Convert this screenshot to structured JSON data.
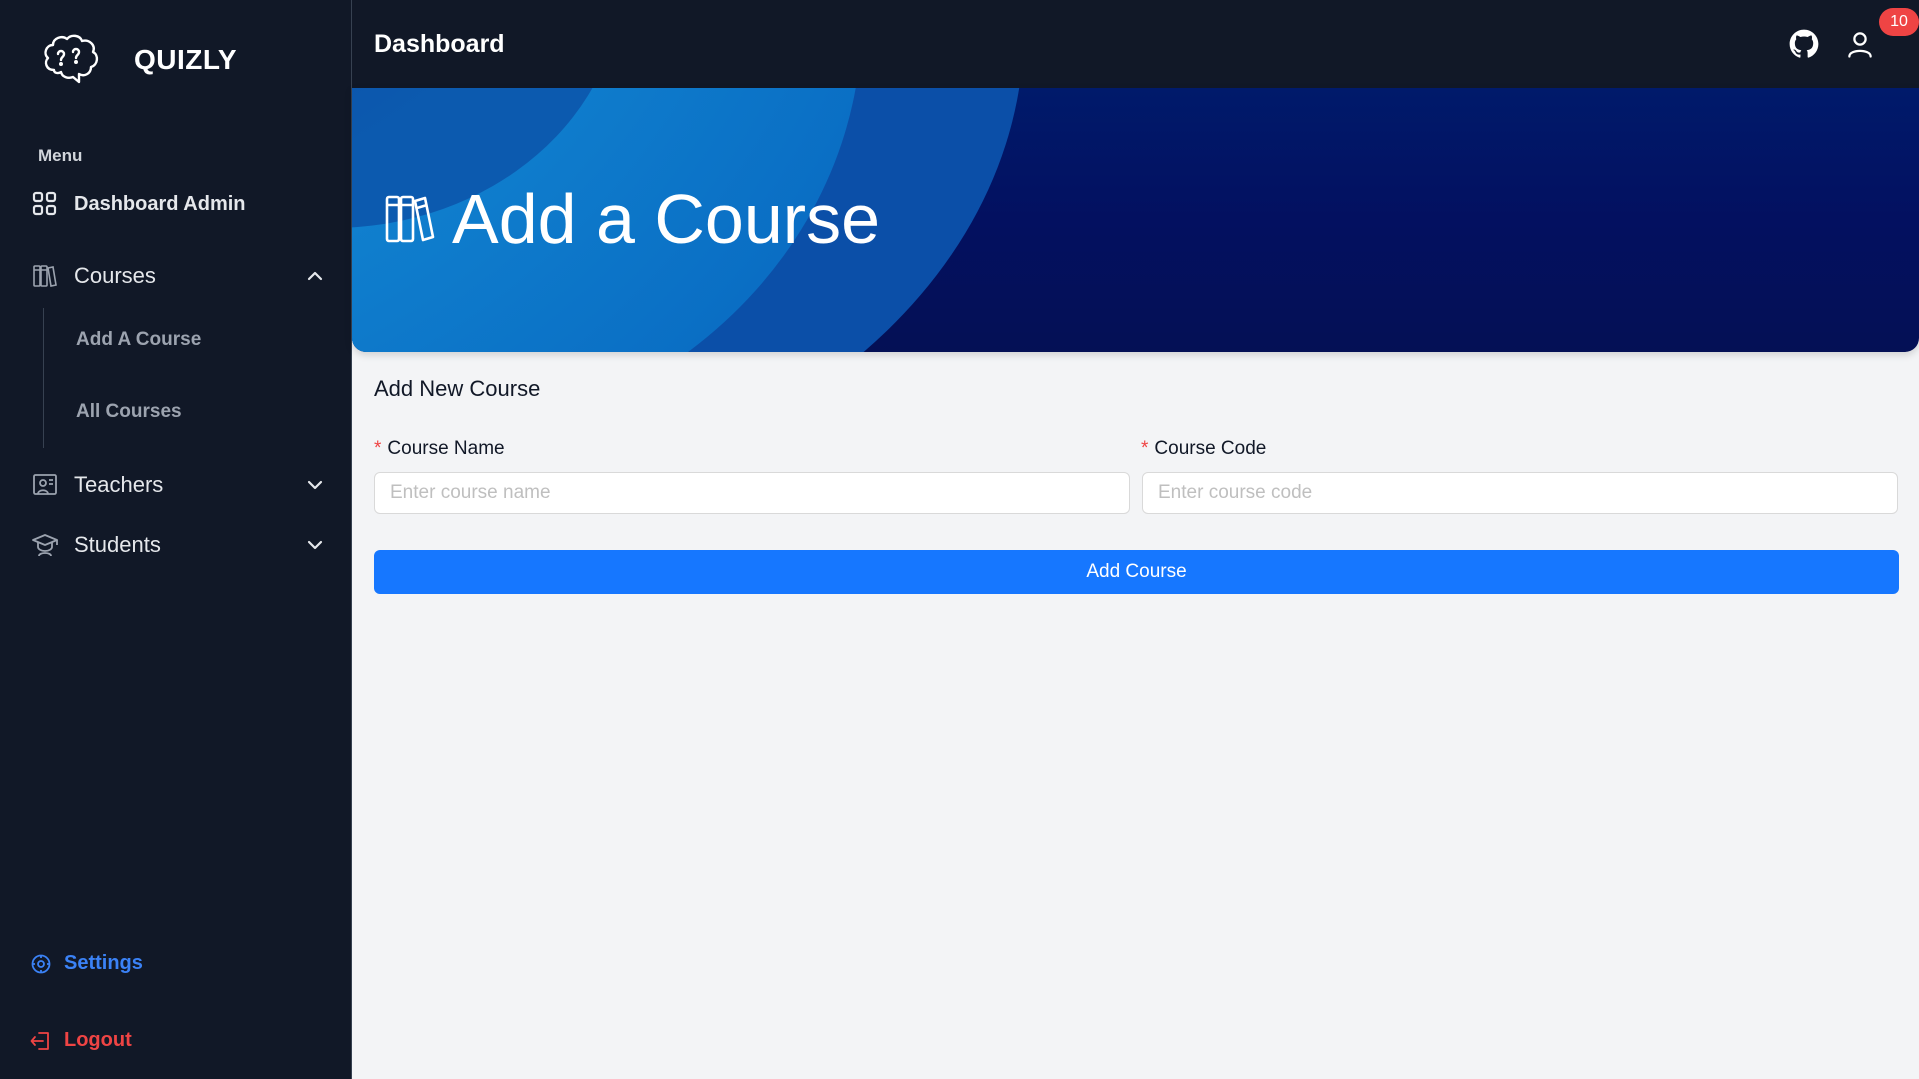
{
  "brand": {
    "name": "QUIZLY"
  },
  "sidebar": {
    "menu_label": "Menu",
    "items": [
      {
        "label": "Dashboard Admin",
        "icon": "grid-icon"
      },
      {
        "label": "Courses",
        "icon": "books-icon",
        "expanded": true,
        "children": [
          {
            "label": "Add A Course"
          },
          {
            "label": "All Courses"
          }
        ]
      },
      {
        "label": "Teachers",
        "icon": "presentation-icon",
        "expanded": false
      },
      {
        "label": "Students",
        "icon": "graduation-cap-icon",
        "expanded": false
      }
    ],
    "settings_label": "Settings",
    "logout_label": "Logout"
  },
  "header": {
    "title": "Dashboard",
    "notification_count": "10"
  },
  "hero": {
    "title": "Add a Course"
  },
  "form": {
    "title": "Add New Course",
    "course_name_label": "Course Name",
    "course_name_placeholder": "Enter course name",
    "course_code_label": "Course Code",
    "course_code_placeholder": "Enter course code",
    "required_marker": "*",
    "submit_label": "Add Course"
  },
  "colors": {
    "sidebar_bg": "#111827",
    "accent": "#1677ff",
    "danger": "#ef4444",
    "link": "#3b82f6"
  }
}
